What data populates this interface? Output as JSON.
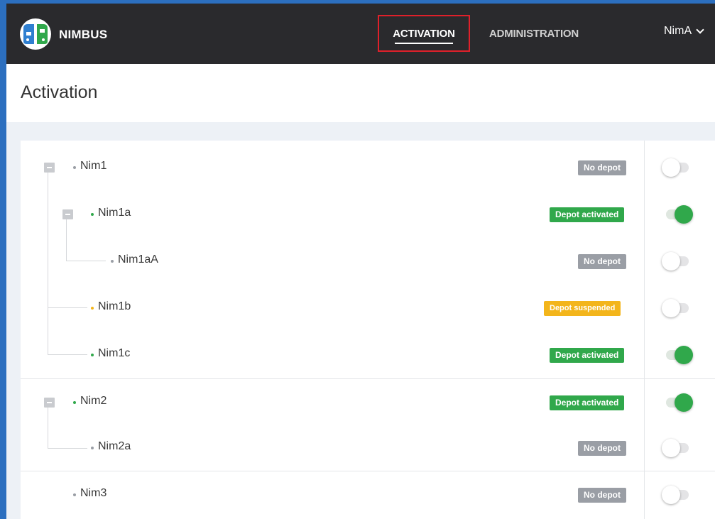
{
  "app": {
    "brand": "NIMBUS",
    "nav": {
      "activation": "ACTIVATION",
      "administration": "ADMINISTRATION"
    },
    "user": "NimA"
  },
  "page": {
    "title": "Activation"
  },
  "colors": {
    "topbar": "#2a2a2d",
    "active_green": "#30a84b",
    "badge_gray": "#9a9ea5",
    "badge_green": "#30a84b",
    "badge_yellow": "#f3b51b",
    "active_tab_outline": "#e0202a"
  },
  "tree": [
    {
      "label": "Nim1",
      "status": "No depot",
      "status_type": "none",
      "enabled": false,
      "collapsible": true,
      "dot": "#9a9ea5"
    },
    {
      "label": "Nim1a",
      "status": "Depot activated",
      "status_type": "activated",
      "enabled": true,
      "collapsible": true,
      "dot": "#30a84b"
    },
    {
      "label": "Nim1aA",
      "status": "No depot",
      "status_type": "none",
      "enabled": false,
      "collapsible": false,
      "dot": "#9a9ea5"
    },
    {
      "label": "Nim1b",
      "status": "Depot suspended",
      "status_type": "suspended",
      "enabled": false,
      "collapsible": false,
      "dot": "#f3b51b"
    },
    {
      "label": "Nim1c",
      "status": "Depot activated",
      "status_type": "activated",
      "enabled": true,
      "collapsible": false,
      "dot": "#30a84b"
    },
    {
      "label": "Nim2",
      "status": "Depot activated",
      "status_type": "activated",
      "enabled": true,
      "collapsible": true,
      "dot": "#30a84b"
    },
    {
      "label": "Nim2a",
      "status": "No depot",
      "status_type": "none",
      "enabled": false,
      "collapsible": false,
      "dot": "#9a9ea5"
    },
    {
      "label": "Nim3",
      "status": "No depot",
      "status_type": "none",
      "enabled": false,
      "collapsible": false,
      "dot": "#9a9ea5"
    }
  ]
}
